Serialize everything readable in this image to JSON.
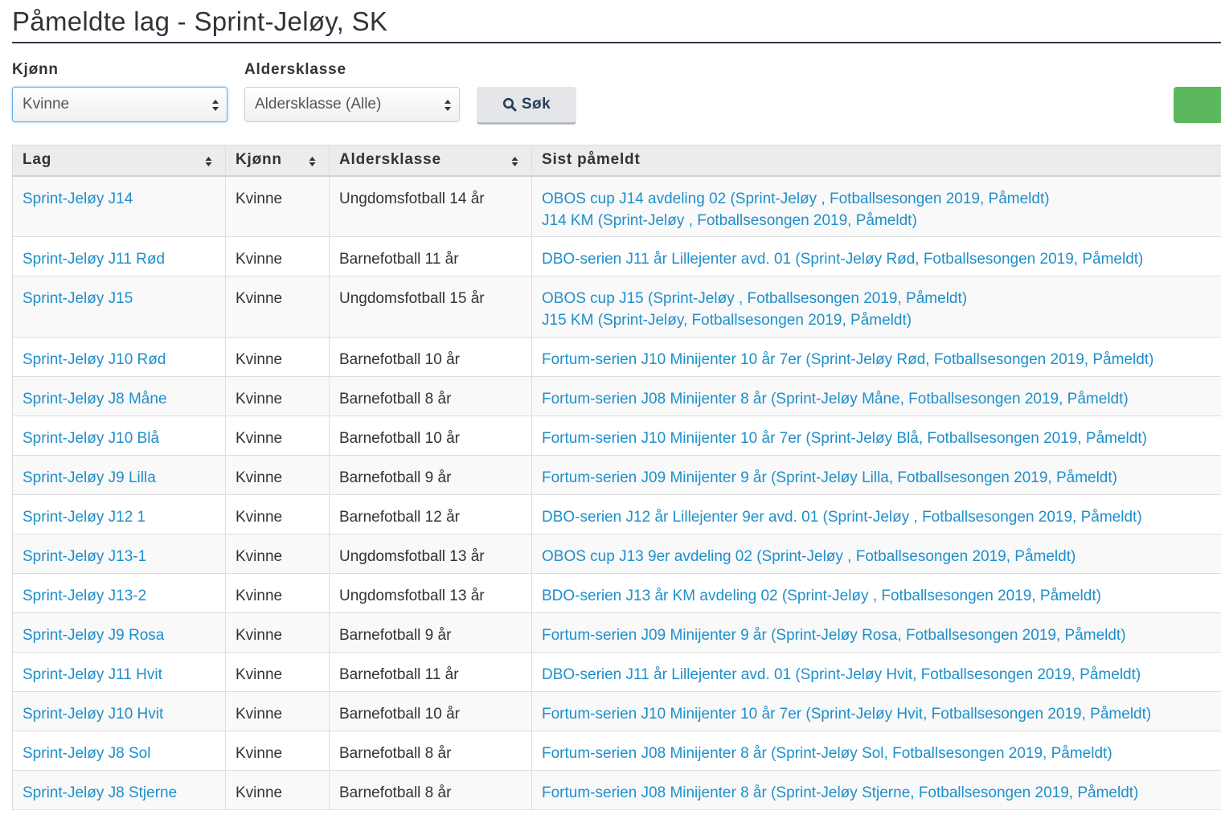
{
  "page": {
    "title": "Påmeldte lag - Sprint-Jeløy, SK"
  },
  "filters": {
    "gender_label": "Kjønn",
    "gender_value": "Kvinne",
    "age_label": "Aldersklasse",
    "age_value": "Aldersklasse (Alle)",
    "search_label": "Søk"
  },
  "colors": {
    "link": "#1e8fcb",
    "accent_green": "#5cb85c",
    "focus_border": "#66afe9"
  },
  "table": {
    "headers": [
      "Lag",
      "Kjønn",
      "Aldersklasse",
      "Sist påmeldt"
    ],
    "rows": [
      {
        "team": "Sprint-Jeløy J14",
        "gender": "Kvinne",
        "age": "Ungdomsfotball 14 år",
        "entries": [
          "OBOS cup J14 avdeling 02 (Sprint-Jeløy , Fotballsesongen 2019, Påmeldt)",
          "J14 KM (Sprint-Jeløy , Fotballsesongen 2019, Påmeldt)"
        ]
      },
      {
        "team": "Sprint-Jeløy J11 Rød",
        "gender": "Kvinne",
        "age": "Barnefotball 11 år",
        "entries": [
          "DBO-serien J11 år Lillejenter avd. 01 (Sprint-Jeløy Rød, Fotballsesongen 2019, Påmeldt)"
        ]
      },
      {
        "team": "Sprint-Jeløy J15",
        "gender": "Kvinne",
        "age": "Ungdomsfotball 15 år",
        "entries": [
          "OBOS cup J15 (Sprint-Jeløy , Fotballsesongen 2019, Påmeldt)",
          "J15 KM (Sprint-Jeløy, Fotballsesongen 2019, Påmeldt)"
        ]
      },
      {
        "team": "Sprint-Jeløy J10 Rød",
        "gender": "Kvinne",
        "age": "Barnefotball 10 år",
        "entries": [
          "Fortum-serien J10 Minijenter 10 år 7er (Sprint-Jeløy Rød, Fotballsesongen 2019, Påmeldt)"
        ]
      },
      {
        "team": "Sprint-Jeløy J8 Måne",
        "gender": "Kvinne",
        "age": "Barnefotball 8 år",
        "entries": [
          "Fortum-serien J08 Minijenter 8 år (Sprint-Jeløy Måne, Fotballsesongen 2019, Påmeldt)"
        ]
      },
      {
        "team": "Sprint-Jeløy J10 Blå",
        "gender": "Kvinne",
        "age": "Barnefotball 10 år",
        "entries": [
          "Fortum-serien J10 Minijenter 10 år 7er (Sprint-Jeløy Blå, Fotballsesongen 2019, Påmeldt)"
        ]
      },
      {
        "team": "Sprint-Jeløy J9 Lilla",
        "gender": "Kvinne",
        "age": "Barnefotball 9 år",
        "entries": [
          "Fortum-serien J09 Minijenter 9 år (Sprint-Jeløy Lilla, Fotballsesongen 2019, Påmeldt)"
        ]
      },
      {
        "team": "Sprint-Jeløy J12 1",
        "gender": "Kvinne",
        "age": "Barnefotball 12 år",
        "entries": [
          "DBO-serien J12 år Lillejenter 9er avd. 01 (Sprint-Jeløy , Fotballsesongen 2019, Påmeldt)"
        ]
      },
      {
        "team": "Sprint-Jeløy J13-1",
        "gender": "Kvinne",
        "age": "Ungdomsfotball 13 år",
        "entries": [
          "OBOS cup J13 9er avdeling 02 (Sprint-Jeløy , Fotballsesongen 2019, Påmeldt)"
        ]
      },
      {
        "team": "Sprint-Jeløy J13-2",
        "gender": "Kvinne",
        "age": "Ungdomsfotball 13 år",
        "entries": [
          "BDO-serien J13 år KM avdeling 02 (Sprint-Jeløy , Fotballsesongen 2019, Påmeldt)"
        ]
      },
      {
        "team": "Sprint-Jeløy J9 Rosa",
        "gender": "Kvinne",
        "age": "Barnefotball 9 år",
        "entries": [
          "Fortum-serien J09 Minijenter 9 år (Sprint-Jeløy Rosa, Fotballsesongen 2019, Påmeldt)"
        ]
      },
      {
        "team": "Sprint-Jeløy J11 Hvit",
        "gender": "Kvinne",
        "age": "Barnefotball 11 år",
        "entries": [
          "DBO-serien J11 år Lillejenter avd. 01 (Sprint-Jeløy Hvit, Fotballsesongen 2019, Påmeldt)"
        ]
      },
      {
        "team": "Sprint-Jeløy J10 Hvit",
        "gender": "Kvinne",
        "age": "Barnefotball 10 år",
        "entries": [
          "Fortum-serien J10 Minijenter 10 år 7er (Sprint-Jeløy Hvit, Fotballsesongen 2019, Påmeldt)"
        ]
      },
      {
        "team": "Sprint-Jeløy J8 Sol",
        "gender": "Kvinne",
        "age": "Barnefotball 8 år",
        "entries": [
          "Fortum-serien J08 Minijenter 8 år (Sprint-Jeløy Sol, Fotballsesongen 2019, Påmeldt)"
        ]
      },
      {
        "team": "Sprint-Jeløy J8 Stjerne",
        "gender": "Kvinne",
        "age": "Barnefotball 8 år",
        "entries": [
          "Fortum-serien J08 Minijenter 8 år (Sprint-Jeløy Stjerne, Fotballsesongen 2019, Påmeldt)"
        ]
      }
    ]
  }
}
